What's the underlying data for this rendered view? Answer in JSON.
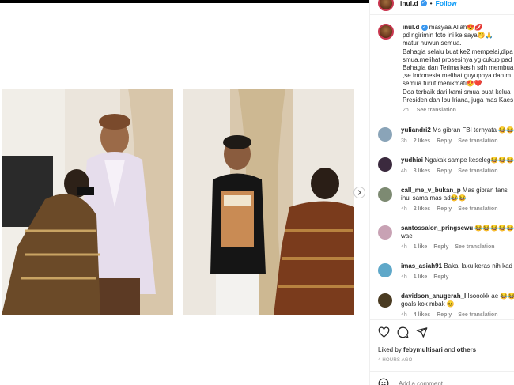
{
  "post": {
    "username": "inul.d",
    "follow_label": "Follow",
    "separator": "•"
  },
  "caption": {
    "username": "inul.d",
    "lines": [
      "masyaa Allah😍💋",
      "pd ngirimin foto ini ke saya🤭🙏",
      "matur nuwun semua.",
      "Bahagia selalu buat ke2 mempelai,dipa",
      "smua,melihat prosesinya yg cukup pad",
      "Bahagia dan Terima kasih sdh membua",
      ",se Indonesia melihat guyupnya dan m",
      "semua turut menikmati😍❤️",
      "Doa terbaik dari kami smua buat kelua",
      "Presiden dan Ibu Iriana, juga mas Kaes"
    ],
    "time": "2h",
    "see_translation": "See translation"
  },
  "comments": [
    {
      "username": "yuliandri2",
      "text": "Ms gibran FBI ternyata 😂😂",
      "time": "3h",
      "likes": "2 likes",
      "reply": "Reply",
      "see_translation": "See translation",
      "extra": ""
    },
    {
      "username": "yudhiai",
      "text": "Ngakak sampe keseleg😂😂😂",
      "time": "4h",
      "likes": "3 likes",
      "reply": "Reply",
      "see_translation": "See translation",
      "extra": ""
    },
    {
      "username": "call_me_v_bukan_p",
      "text": "Mas gibran fans",
      "extra": "inul sama mas ad😂😂",
      "time": "4h",
      "likes": "2 likes",
      "reply": "Reply",
      "see_translation": "See translation"
    },
    {
      "username": "santossalon_pringsewu",
      "text": "😂😂😂😂😂",
      "extra": "wae",
      "time": "4h",
      "likes": "1 like",
      "reply": "Reply",
      "see_translation": "See translation"
    },
    {
      "username": "imas_asiah91",
      "text": "Bakal laku keras nih kad",
      "time": "4h",
      "likes": "1 like",
      "reply": "Reply",
      "see_translation": "",
      "extra": ""
    },
    {
      "username": "davidson_anugerah_l",
      "text": "Isoookk ae 😂😂",
      "extra": "goals kok mbak 😊",
      "time": "4h",
      "likes": "4 likes",
      "reply": "Reply",
      "see_translation": "See translation"
    }
  ],
  "liked_by": {
    "prefix": "Liked by ",
    "user": "febymultisari",
    "middle": " and ",
    "others": "others"
  },
  "time_ago": "4 HOURS AGO",
  "add_comment_placeholder": "Add a comment...",
  "icons": [
    "verified-icon",
    "heart-icon",
    "comment-icon",
    "share-icon",
    "emoji-icon",
    "chevron-right-icon"
  ],
  "colors": {
    "link": "#0095f6",
    "muted": "#8e8e8e",
    "text": "#262626",
    "verified": "#3897f0",
    "story_ring": "#c9364f"
  }
}
